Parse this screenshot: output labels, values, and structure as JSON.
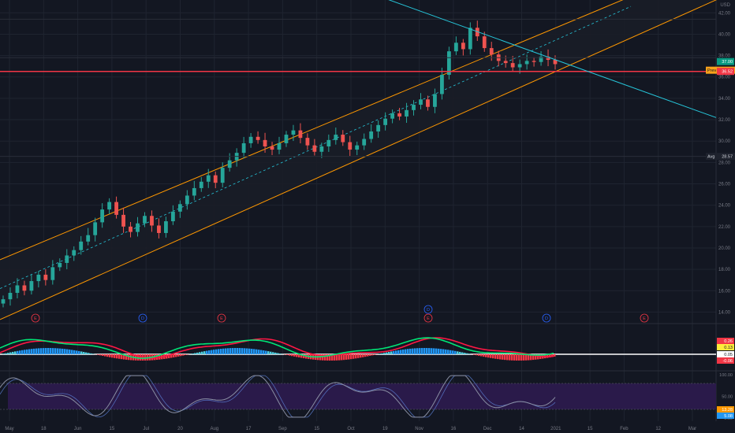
{
  "chart_data": {
    "type": "candlestick",
    "price_axis": {
      "currency": "USD",
      "ticks": [
        "14.00",
        "16.00",
        "18.00",
        "20.00",
        "22.00",
        "24.00",
        "26.00",
        "28.00",
        "30.00",
        "32.00",
        "34.00",
        "36.00",
        "38.00",
        "40.00",
        "42.00"
      ],
      "ylim": [
        13.0,
        43.2
      ]
    },
    "time_axis": {
      "ticks": [
        "May",
        "18",
        "Jun",
        "15",
        "Jul",
        "20",
        "Aug",
        "17",
        "Sep",
        "15",
        "Oct",
        "19",
        "Nov",
        "16",
        "Dec",
        "14",
        "2021",
        "15",
        "Feb",
        "12",
        "Mar"
      ]
    },
    "price_close": [
      15.2,
      15.8,
      16.5,
      16.0,
      16.9,
      17.5,
      17.0,
      18.2,
      18.6,
      19.3,
      19.8,
      20.6,
      21.2,
      22.4,
      23.6,
      24.3,
      23.1,
      22.0,
      21.5,
      22.3,
      23.0,
      22.1,
      21.4,
      22.5,
      23.4,
      24.1,
      24.9,
      25.6,
      26.2,
      26.8,
      26.1,
      27.5,
      28.2,
      28.9,
      29.8,
      30.4,
      30.1,
      29.5,
      29.2,
      29.8,
      30.6,
      31.0,
      30.3,
      29.6,
      29.0,
      29.5,
      30.1,
      30.6,
      29.9,
      29.2,
      29.6,
      30.2,
      30.9,
      31.5,
      32.1,
      32.6,
      32.3,
      32.9,
      33.4,
      33.9,
      33.2,
      34.4,
      36.2,
      38.4,
      39.2,
      38.6,
      40.6,
      39.8,
      38.7,
      38.1,
      37.5,
      37.3,
      36.9,
      37.2,
      37.5,
      37.4,
      37.9,
      37.6,
      37.2
    ],
    "last_price": "37.00",
    "horizontal_levels": [
      {
        "label": "Avg",
        "value": "28.57",
        "color": "#2962ff"
      },
      {
        "value": "36.52",
        "color": "#f23645"
      },
      {
        "label": "Prev",
        "value": "37.00",
        "color": "#f7a21b"
      },
      {
        "value": "37.00",
        "color": "#089981"
      }
    ],
    "earnings_markers": [
      "E",
      "D",
      "E",
      "D",
      "E",
      "D",
      "E"
    ],
    "oscillator_1": {
      "labels": [
        "0.26",
        "0.13",
        "0.05",
        "-0.06"
      ],
      "zero_line": true
    },
    "oscillator_2": {
      "ticks": [
        "100.00",
        "50.00",
        "0.00"
      ],
      "labels": [
        "13.28",
        "5.08"
      ],
      "band": [
        20,
        80
      ]
    },
    "colors": {
      "background": "#131722",
      "grid": "#1f2430",
      "axis_text": "#787b86",
      "up": "#26a69a",
      "down": "#ef5350",
      "channel": "#ff9800",
      "trendline": "#26c6da",
      "support": "#f23645",
      "band_fill": "#2a1a4a",
      "stoch_line": "#8a8fa3"
    }
  }
}
